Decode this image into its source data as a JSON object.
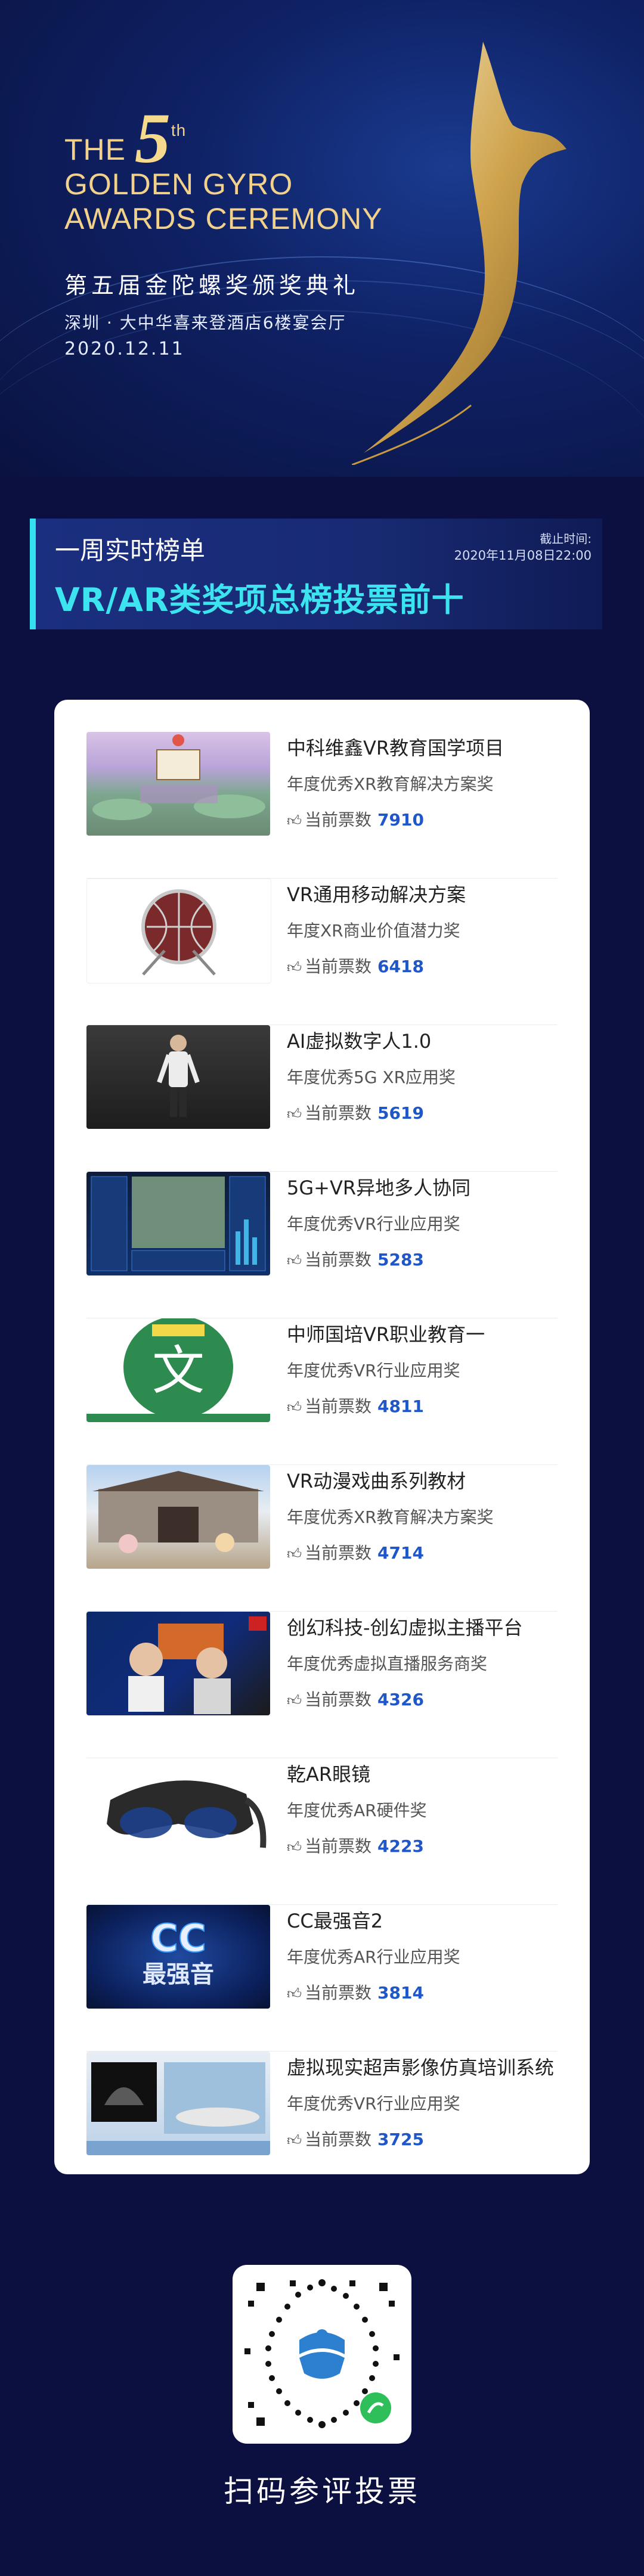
{
  "header": {
    "title_en_the": "THE",
    "title_en_number": "5",
    "title_en_suffix": "th",
    "title_en_line2": "GOLDEN GYRO",
    "title_en_line3": "AWARDS CEREMONY",
    "title_cn": "第五届金陀螺奖颁奖典礼",
    "venue": "深圳 · 大中华喜来登酒店6楼宴会厅",
    "date": "2020.12.11"
  },
  "ranking": {
    "subtitle": "一周实时榜单",
    "title": "VR/AR类奖项总榜投票前十",
    "deadline_label": "截止时间:",
    "deadline": "2020年11月08日22:00",
    "votes_label": "当前票数"
  },
  "items": [
    {
      "name": "中科维鑫VR教育国学项目",
      "award": "年度优秀XR教育解决方案奖",
      "votes": "7910"
    },
    {
      "name": "VR通用移动解决方案",
      "award": "年度XR商业价值潜力奖",
      "votes": "6418"
    },
    {
      "name": "AI虚拟数字人1.0",
      "award": "年度优秀5G XR应用奖",
      "votes": "5619"
    },
    {
      "name": "5G+VR异地多人协同",
      "award": "年度优秀VR行业应用奖",
      "votes": "5283"
    },
    {
      "name": "中师国培VR职业教育一",
      "award": "年度优秀VR行业应用奖",
      "votes": "4811"
    },
    {
      "name": "VR动漫戏曲系列教材",
      "award": "年度优秀XR教育解决方案奖",
      "votes": "4714"
    },
    {
      "name": "创幻科技-创幻虚拟主播平台",
      "award": "年度优秀虚拟直播服务商奖",
      "votes": "4326"
    },
    {
      "name": "乾AR眼镜",
      "award": "年度优秀AR硬件奖",
      "votes": "4223"
    },
    {
      "name": "CC最强音2",
      "award": "年度优秀AR行业应用奖",
      "votes": "3814"
    },
    {
      "name": "虚拟现实超声影像仿真培训系统",
      "award": "年度优秀VR行业应用奖",
      "votes": "3725"
    }
  ],
  "qr": {
    "caption": "扫码参评投票"
  },
  "thumbnails": {
    "t5_logo_text": "文",
    "t9_text": "CC",
    "t9_text2": "最强音"
  },
  "colors": {
    "background": "#0b1040",
    "accent_cyan": "#3ce4f0",
    "gold": "#f2d18a",
    "vote_blue": "#1f57c8"
  },
  "icons": {
    "vote": "thumbs-up-icon",
    "qr": "qr-code-icon"
  }
}
